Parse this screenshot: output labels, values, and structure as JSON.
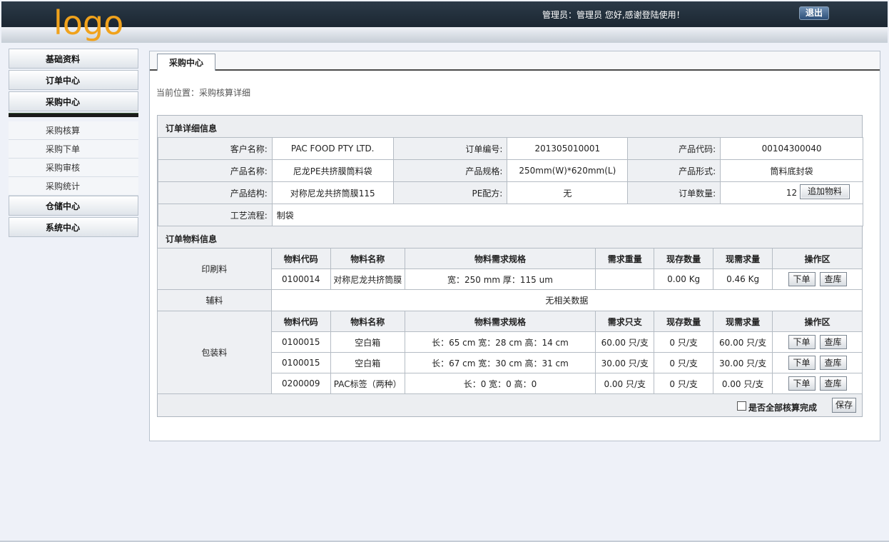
{
  "header": {
    "logo": "logo",
    "welcome": "管理员：管理员  您好,感谢登陆使用！",
    "logout_label": "退出"
  },
  "sidebar": {
    "sections": [
      {
        "label": "基础资料"
      },
      {
        "label": "订单中心"
      },
      {
        "label": "采购中心"
      }
    ],
    "sub_items": [
      {
        "label": "采购核算"
      },
      {
        "label": "采购下单"
      },
      {
        "label": "采购审核"
      },
      {
        "label": "采购统计"
      }
    ],
    "sections_after": [
      {
        "label": "仓储中心"
      },
      {
        "label": "系统中心"
      }
    ]
  },
  "main": {
    "tab": "采购中心",
    "breadcrumb": "当前位置：采购核算详细",
    "order_info": {
      "title": "订单详细信息",
      "rows": [
        [
          {
            "label": "客户名称:",
            "value": "PAC FOOD PTY LTD."
          },
          {
            "label": "订单编号:",
            "value": "201305010001"
          },
          {
            "label": "产品代码:",
            "value": "00104300040"
          }
        ],
        [
          {
            "label": "产品名称:",
            "value": "尼龙PE共挤膜筒料袋"
          },
          {
            "label": "产品规格:",
            "value": "250mm(W)*620mm(L)"
          },
          {
            "label": "产品形式:",
            "value": "筒料底封袋"
          }
        ],
        [
          {
            "label": "产品结构:",
            "value": "对称尼龙共挤筒膜115"
          },
          {
            "label": "PE配方:",
            "value": "无"
          },
          {
            "label": "订单数量:",
            "value": "12"
          }
        ]
      ],
      "process_label": "工艺流程:",
      "process_value": "制袋"
    },
    "materials": {
      "title": "订单物料信息",
      "add_label": "追加物料",
      "print_category": "印刷料",
      "print_headers": [
        "物料代码",
        "物料名称",
        "物料需求规格",
        "需求重量",
        "现存数量",
        "现需求量",
        "操作区"
      ],
      "print_rows": [
        {
          "code": "0100014",
          "name": "对称尼龙共挤筒膜",
          "spec": "宽：250 mm 厚：115 um",
          "need": "",
          "stock": "0.00 Kg",
          "now": "0.46 Kg"
        }
      ],
      "aux_category": "辅料",
      "aux_none": "无相关数据",
      "pack_category": "包装料",
      "pack_headers": [
        "物料代码",
        "物料名称",
        "物料需求规格",
        "需求只支",
        "现存数量",
        "现需求量",
        "操作区"
      ],
      "pack_rows": [
        {
          "code": "0100015",
          "name": "空白箱",
          "spec": "长：65 cm 宽：28 cm 高：14 cm",
          "need": "60.00 只/支",
          "stock": "0 只/支",
          "now": "60.00 只/支"
        },
        {
          "code": "0100015",
          "name": "空白箱",
          "spec": "长：67 cm 宽：30 cm 高：31 cm",
          "need": "30.00 只/支",
          "stock": "0 只/支",
          "now": "30.00 只/支"
        },
        {
          "code": "0200009",
          "name": "PAC标签（两种）",
          "spec": "长：0 宽：0 高：0",
          "need": "0.00 只/支",
          "stock": "0 只/支",
          "now": "0.00 只/支"
        }
      ],
      "order_btn": "下单",
      "stock_btn": "查库",
      "complete_label": "是否全部核算完成",
      "save_label": "保存"
    }
  }
}
